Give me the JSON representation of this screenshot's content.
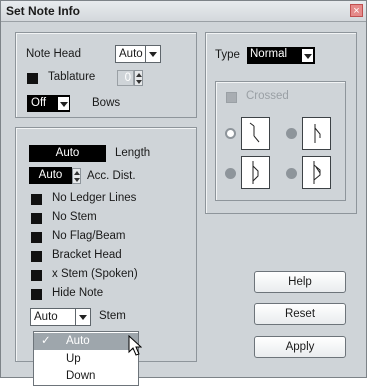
{
  "window": {
    "title": "Set Note Info",
    "close_glyph": "×"
  },
  "head_group": {
    "note_head_label": "Note Head",
    "note_head_value": "Auto",
    "tablature_label": "Tablature",
    "tablature_value": "0",
    "bows_value": "Off",
    "bows_label": "Bows"
  },
  "stem_group": {
    "length_value": "Auto",
    "length_label": "Length",
    "acc_value": "Auto",
    "acc_label": "Acc. Dist.",
    "options": [
      "No Ledger Lines",
      "No Stem",
      "No Flag/Beam",
      "Bracket Head",
      "x Stem (Spoken)",
      "Hide Note"
    ],
    "stem_value": "Auto",
    "stem_label": "Stem"
  },
  "type_group": {
    "type_label": "Type",
    "type_value": "Normal",
    "crossed_label": "Crossed"
  },
  "buttons": {
    "help": "Help",
    "reset": "Reset",
    "apply": "Apply"
  },
  "stem_menu": {
    "check_glyph": "✓",
    "items": [
      "Auto",
      "Up",
      "Down"
    ],
    "selected": "Auto"
  },
  "colors": {
    "dialog_bg": "#cfd4d8",
    "menu_highlight": "#9ea6ac",
    "close": "#e58a8a"
  }
}
